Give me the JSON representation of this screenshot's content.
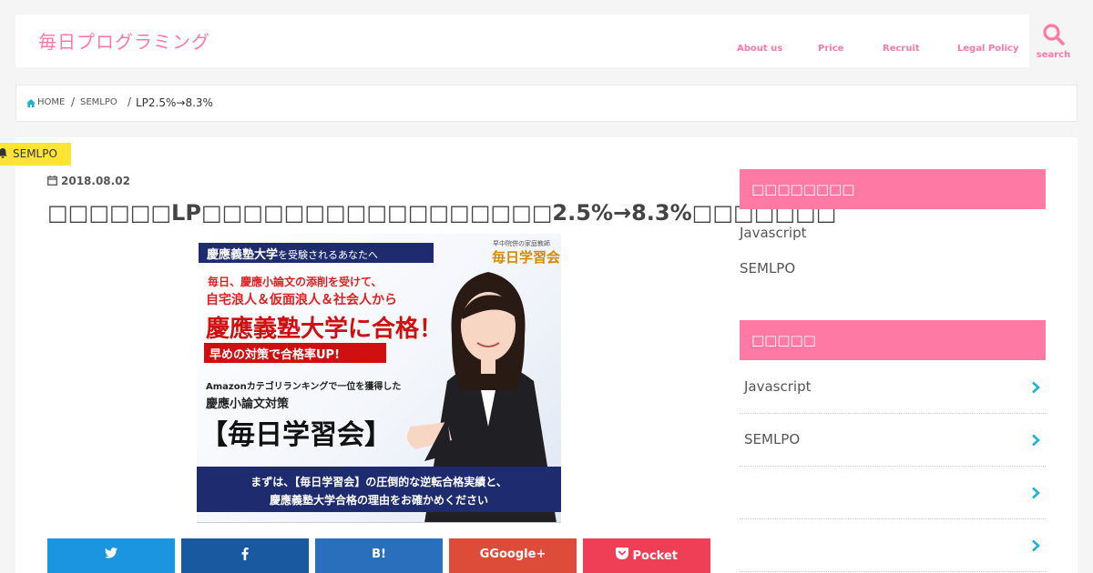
{
  "header": {
    "logo": "毎日プログラミング",
    "nav": [
      "About us",
      "Price",
      "Recruit",
      "Legal Policy"
    ],
    "search_label": "search"
  },
  "breadcrumb": {
    "home": "HOME",
    "category": "SEMLPO",
    "current": "LP2.5%→8.3%"
  },
  "post": {
    "category_badge": "SEMLPO",
    "date": "2018.08.02",
    "title": "□□□□□□LP□□□□□□□□□□□□□□□□□2.5%→8.3%□□□□□□□"
  },
  "hero": {
    "head_bold": "慶應義塾大学",
    "head_rest": "を受験されるあなたへ",
    "brand_small": "早中院併の家庭教師",
    "brand": "毎日学習会",
    "line1": "毎日、慶應小論文の添削を受けて、",
    "line2": "自宅浪人＆仮面浪人＆社会人から",
    "line3": "慶應義塾大学に合格！",
    "line4": "早めの対策で合格率UP!",
    "line5": "Amazonカテゴリランキングで一位を獲得した",
    "line6": "慶應小論文対策",
    "line7": "【毎日学習会】",
    "banner1": "まずは、【毎日学習会】の圧倒的な逆転合格実績と、",
    "banner2": "慶應義塾大学合格の理由をお確かめください"
  },
  "share": {
    "twitter": "",
    "facebook": "",
    "hatena": "B!",
    "google": "Google+",
    "pocket": "Pocket"
  },
  "sidebar": {
    "heading1": "□□□□□□□□",
    "links": [
      "Javascript",
      "SEMLPO"
    ],
    "heading2": "□□□□□",
    "categories": [
      "Javascript",
      "SEMLPO",
      "",
      ""
    ]
  },
  "colors": {
    "accent": "#ff79a5",
    "badge": "#ffe533",
    "twitter": "#1b95e0",
    "facebook": "#18599f",
    "hatena": "#2a6fbb",
    "google": "#dd4b39",
    "pocket": "#ef3f56",
    "chevron": "#1bb4d3"
  }
}
